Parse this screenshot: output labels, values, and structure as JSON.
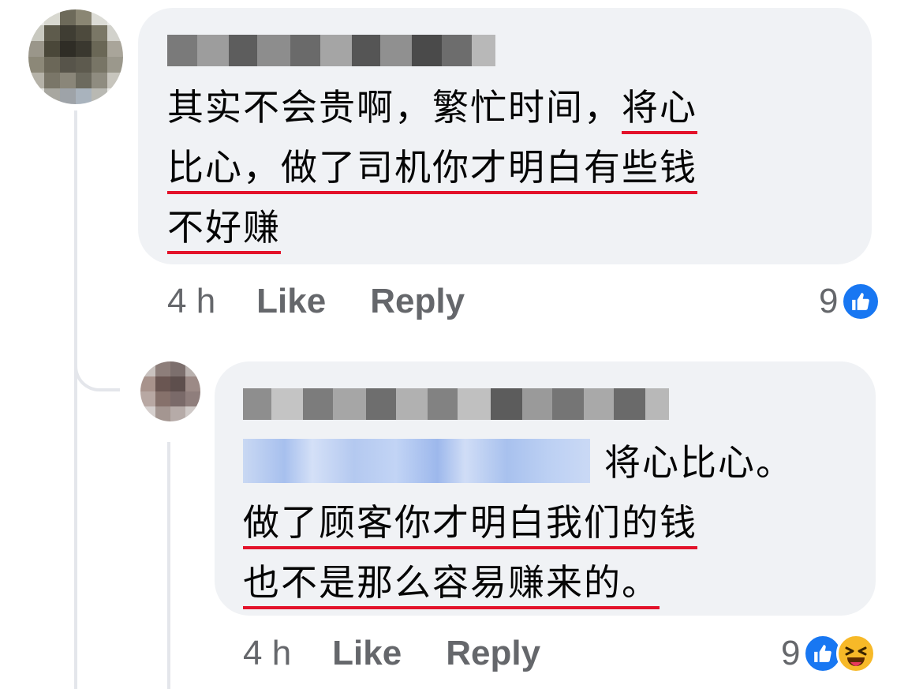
{
  "comment": {
    "author": "",
    "text_lines": [
      [
        "其实不会贵啊，繁忙时间，",
        "将心"
      ],
      [
        "比心，做了司机你才明白有些钱"
      ],
      [
        "不好赚"
      ]
    ],
    "time": "4 h",
    "like_label": "Like",
    "reply_label": "Reply",
    "reaction_count": "9",
    "reactions": [
      "like-icon"
    ]
  },
  "reply": {
    "author": "",
    "mention": "",
    "text_after_mention": "将心比心。",
    "text_lines": [
      "做了顾客你才明白我们的钱",
      "也不是那么容易赚来的。"
    ],
    "time": "4 h",
    "like_label": "Like",
    "reply_label": "Reply",
    "reaction_count": "9",
    "reactions": [
      "like-icon",
      "haha-icon"
    ]
  },
  "colors": {
    "bubble": "#f0f2f5",
    "text": "#050505",
    "meta": "#65676b",
    "underline": "#e3122a",
    "like_blue": "#1877f2",
    "haha_yellow": "#f7b928"
  }
}
